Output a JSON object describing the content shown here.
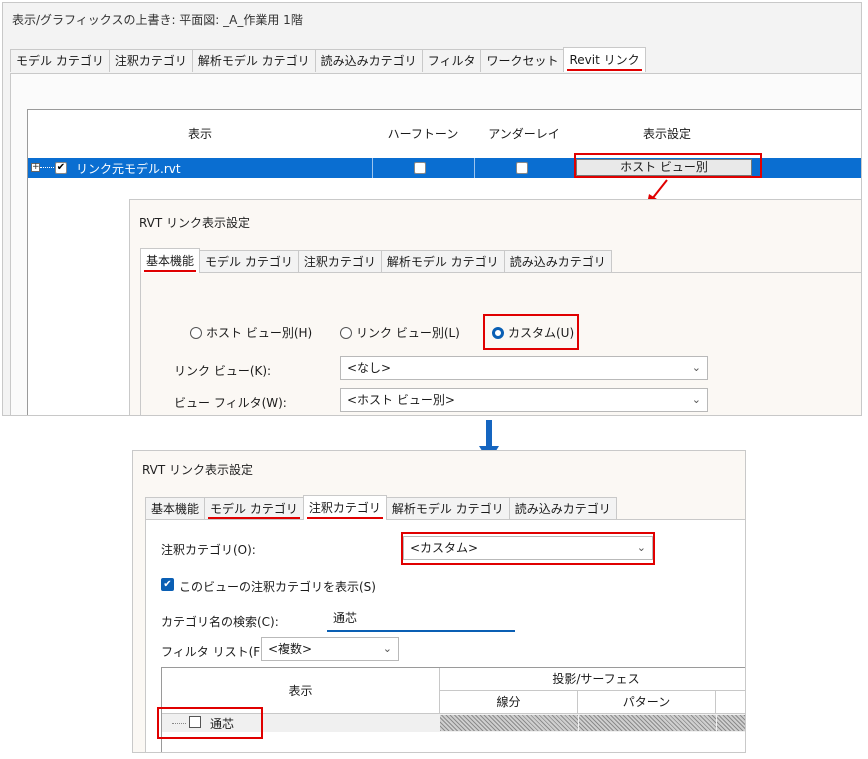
{
  "top_window": {
    "title": "表示/グラフィックスの上書き: 平面図: _A_作業用 1階",
    "tabs": [
      "モデル カテゴリ",
      "注釈カテゴリ",
      "解析モデル カテゴリ",
      "読み込みカテゴリ",
      "フィルタ",
      "ワークセット",
      "Revit リンク"
    ],
    "active_tab": "Revit リンク",
    "grid": {
      "headers": [
        "表示",
        "ハーフトーン",
        "アンダーレイ",
        "表示設定"
      ],
      "row": {
        "name": "リンク元モデル.rvt",
        "display_checked": true,
        "halftone_checked": false,
        "underlay_checked": false,
        "display_setting_button": "ホスト ビュー別"
      }
    }
  },
  "dialog1": {
    "title": "RVT リンク表示設定",
    "tabs": [
      "基本機能",
      "モデル カテゴリ",
      "注釈カテゴリ",
      "解析モデル カテゴリ",
      "読み込みカテゴリ"
    ],
    "active_tab": "基本機能",
    "radios": [
      "ホスト ビュー別(H)",
      "リンク ビュー別(L)",
      "カスタム(U)"
    ],
    "selected_radio": "カスタム(U)",
    "link_view_label": "リンク ビュー(K):",
    "link_view_value": "<なし>",
    "view_filter_label": "ビュー フィルタ(W):",
    "view_filter_value": "<ホスト ビュー別>"
  },
  "dialog2": {
    "title": "RVT リンク表示設定",
    "tabs": [
      "基本機能",
      "モデル カテゴリ",
      "注釈カテゴリ",
      "解析モデル カテゴリ",
      "読み込みカテゴリ"
    ],
    "active_tab": "注釈カテゴリ",
    "annotation_category_label": "注釈カテゴリ(O):",
    "annotation_category_value": "<カスタム>",
    "show_checkbox_label": "このビューの注釈カテゴリを表示(S)",
    "show_checkbox_checked": true,
    "search_label": "カテゴリ名の検索(C):",
    "search_value": "通芯",
    "filter_list_label": "フィルタ リスト(F):",
    "filter_list_value": "<複数>",
    "grid": {
      "col_display": "表示",
      "group_header": "投影/サーフェス",
      "sub_headers": [
        "線分",
        "パターン"
      ],
      "row_label": "通芯",
      "row_checked": false
    }
  },
  "colors": {
    "highlight_red": "#e00000",
    "selection_blue": "#0a6ed1",
    "arrow_blue": "#1565c0"
  }
}
